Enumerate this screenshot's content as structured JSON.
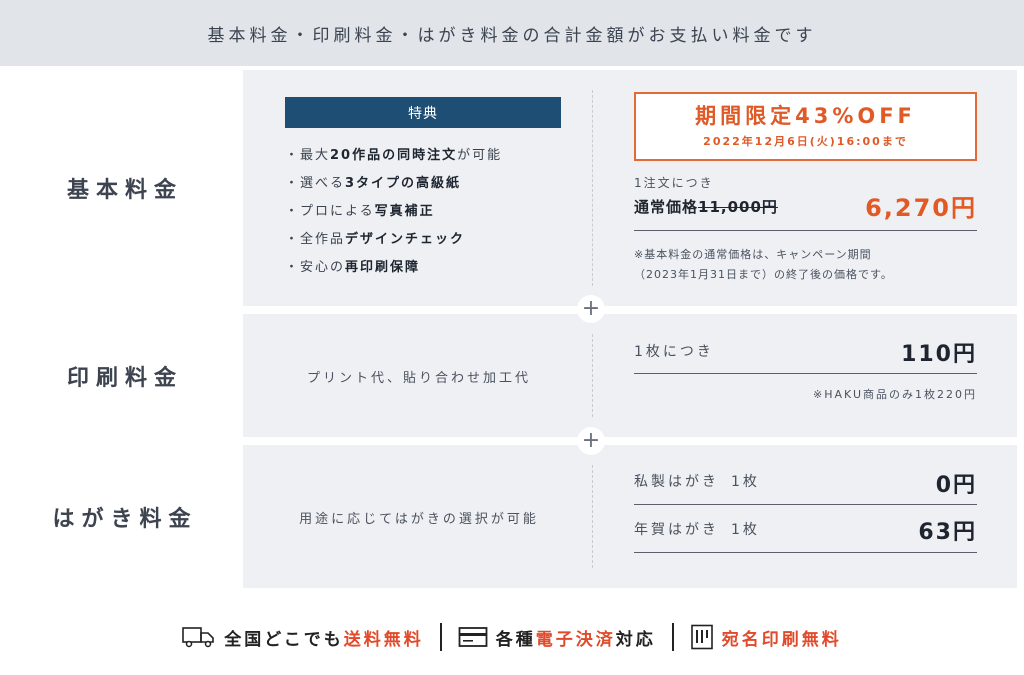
{
  "banner": {
    "text": "基本料金・印刷料金・はがき料金の合計金額がお支払い料金です"
  },
  "basic": {
    "label": "基本料金",
    "tokuten": "特典",
    "benefits": [
      {
        "pre": "・最大",
        "bold": "20作品の同時注文",
        "post": "が可能"
      },
      {
        "pre": "・選べる",
        "bold": "3タイプの高級紙",
        "post": ""
      },
      {
        "pre": "・プロによる",
        "bold": "写真補正",
        "post": ""
      },
      {
        "pre": "・全作品",
        "bold": "デザインチェック",
        "post": ""
      },
      {
        "pre": "・安心の",
        "bold": "再印刷保障",
        "post": ""
      }
    ],
    "promo_title": "期間限定43%OFF",
    "promo_date": "2022年12月6日(火)16:00まで",
    "per_order": "1注文につき",
    "regular_label": "通常価格",
    "regular_price": "11,000円",
    "sale_price": "6,270円",
    "note_line1": "※基本料金の通常価格は、キャンペーン期間",
    "note_line2": "（2023年1月31日まで）の終了後の価格です。"
  },
  "print": {
    "label": "印刷料金",
    "desc": "プリント代、貼り合わせ加工代",
    "per_sheet": "1枚につき",
    "price": "110円",
    "note": "※HAKU商品のみ1枚220円"
  },
  "postcard": {
    "label": "はがき料金",
    "desc": "用途に応じてはがきの選択が可能",
    "items": [
      {
        "name": "私製はがき",
        "qty": "1枚",
        "price": "0円"
      },
      {
        "name": "年賀はがき",
        "qty": "1枚",
        "price": "63円"
      }
    ]
  },
  "plus_symbol": "+",
  "features": {
    "shipping": {
      "pre": "全国どこでも",
      "accent": "送料無料",
      "icon": "truck-icon"
    },
    "payment": {
      "pre": "各種",
      "accent": "電子決済",
      "post": "対応",
      "icon": "card-icon"
    },
    "address": {
      "accent": "宛名印刷無料",
      "icon": "address-print-icon"
    }
  },
  "colors": {
    "accent": "#e15a26",
    "navy": "#1f4e74",
    "panel": "#eef0f3",
    "banner": "#e1e5ea"
  }
}
